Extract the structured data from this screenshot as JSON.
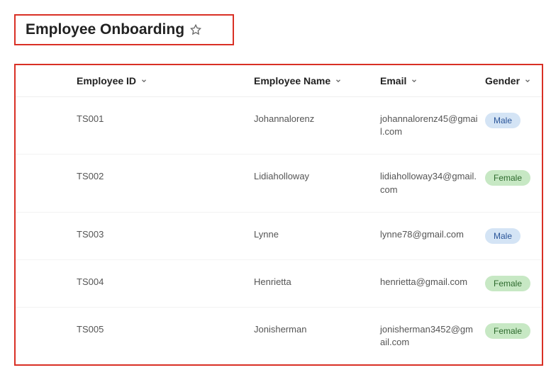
{
  "title": "Employee Onboarding",
  "columns": {
    "id": "Employee ID",
    "name": "Employee Name",
    "email": "Email",
    "gender": "Gender"
  },
  "rows": [
    {
      "id": "TS001",
      "name": "Johannalorenz",
      "email": "johannalorenz45@gmail.com",
      "gender": "Male"
    },
    {
      "id": "TS002",
      "name": "Lidiaholloway",
      "email": "lidiaholloway34@gmail.com",
      "gender": "Female"
    },
    {
      "id": "TS003",
      "name": "Lynne",
      "email": "lynne78@gmail.com",
      "gender": "Male"
    },
    {
      "id": "TS004",
      "name": "Henrietta",
      "email": "henrietta@gmail.com",
      "gender": "Female"
    },
    {
      "id": "TS005",
      "name": "Jonisherman",
      "email": "jonisherman3452@gmail.com",
      "gender": "Female"
    }
  ]
}
